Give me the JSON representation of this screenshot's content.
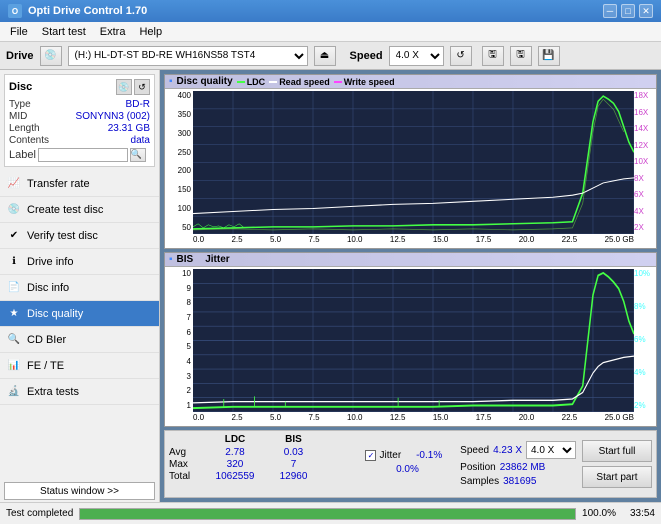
{
  "titleBar": {
    "title": "Opti Drive Control 1.70",
    "minimize": "─",
    "maximize": "□",
    "close": "✕"
  },
  "menuBar": {
    "items": [
      "File",
      "Start test",
      "Extra",
      "Help"
    ]
  },
  "driveBar": {
    "label": "Drive",
    "driveValue": "(H:) HL-DT-ST BD-RE  WH16NS58 TST4",
    "speedLabel": "Speed",
    "speedValue": "4.0 X"
  },
  "disc": {
    "sectionLabel": "Disc",
    "fields": [
      {
        "key": "Type",
        "val": "BD-R"
      },
      {
        "key": "MID",
        "val": "SONYNN3 (002)"
      },
      {
        "key": "Length",
        "val": "23.31 GB"
      },
      {
        "key": "Contents",
        "val": "data"
      },
      {
        "key": "Label",
        "val": ""
      }
    ]
  },
  "navItems": [
    {
      "id": "transfer-rate",
      "label": "Transfer rate",
      "icon": "📈"
    },
    {
      "id": "create-test-disc",
      "label": "Create test disc",
      "icon": "💿"
    },
    {
      "id": "verify-test-disc",
      "label": "Verify test disc",
      "icon": "✔"
    },
    {
      "id": "drive-info",
      "label": "Drive info",
      "icon": "ℹ"
    },
    {
      "id": "disc-info",
      "label": "Disc info",
      "icon": "📄"
    },
    {
      "id": "disc-quality",
      "label": "Disc quality",
      "icon": "★",
      "active": true
    },
    {
      "id": "cd-bier",
      "label": "CD BIer",
      "icon": "🔍"
    },
    {
      "id": "fe-te",
      "label": "FE / TE",
      "icon": "📊"
    },
    {
      "id": "extra-tests",
      "label": "Extra tests",
      "icon": "🔬"
    }
  ],
  "statusWindowBtn": "Status window >>",
  "chartTop": {
    "title": "Disc quality",
    "legendLDC": "LDC",
    "legendRead": "Read speed",
    "legendWrite": "Write speed",
    "yLabels": [
      "400",
      "350",
      "300",
      "250",
      "200",
      "150",
      "100",
      "50"
    ],
    "yLabelsRight": [
      "18X",
      "16X",
      "14X",
      "12X",
      "10X",
      "8X",
      "6X",
      "4X",
      "2X"
    ],
    "xLabels": [
      "0.0",
      "2.5",
      "5.0",
      "7.5",
      "10.0",
      "12.5",
      "15.0",
      "17.5",
      "20.0",
      "22.5",
      "25.0 GB"
    ]
  },
  "chartBottom": {
    "titleBIS": "BIS",
    "titleJitter": "Jitter",
    "yLabels": [
      "10",
      "9",
      "8",
      "7",
      "6",
      "5",
      "4",
      "3",
      "2",
      "1"
    ],
    "yLabelsRight": [
      "10%",
      "8%",
      "6%",
      "4%",
      "2%"
    ],
    "xLabels": [
      "0.0",
      "2.5",
      "5.0",
      "7.5",
      "10.0",
      "12.5",
      "15.0",
      "17.5",
      "20.0",
      "22.5",
      "25.0 GB"
    ]
  },
  "stats": {
    "headers": [
      "",
      "LDC",
      "BIS",
      "",
      "Jitter"
    ],
    "rows": [
      {
        "label": "Avg",
        "ldc": "2.78",
        "bis": "0.03",
        "jitter": "-0.1%"
      },
      {
        "label": "Max",
        "ldc": "320",
        "bis": "7",
        "jitter": "0.0%"
      },
      {
        "label": "Total",
        "ldc": "1062559",
        "bis": "12960",
        "jitter": ""
      }
    ],
    "jitterChecked": true,
    "speedLabel": "Speed",
    "speedVal": "4.23 X",
    "speedSelect": "4.0 X",
    "positionLabel": "Position",
    "positionVal": "23862 MB",
    "samplesLabel": "Samples",
    "samplesVal": "381695",
    "startFullBtn": "Start full",
    "startPartBtn": "Start part"
  },
  "statusBar": {
    "text": "Test completed",
    "progress": 100,
    "progressText": "100.0%",
    "time": "33:54"
  },
  "colors": {
    "ldcLine": "#44ff44",
    "readLine": "#ffffff",
    "writeLine": "#ff44ff",
    "bisLine": "#44ff44",
    "jitterLine": "#ffffff",
    "chartBg": "#1a2540",
    "gridLine": "#3a5080",
    "accent": "#0000cc"
  }
}
